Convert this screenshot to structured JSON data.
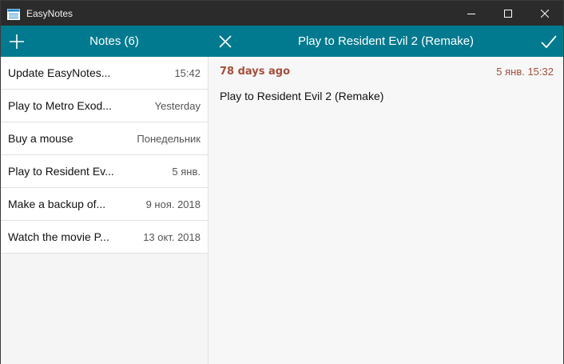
{
  "app": {
    "title": "EasyNotes"
  },
  "header": {
    "notes_title": "Notes (6)",
    "note_title": "Play to Resident Evil 2 (Remake)"
  },
  "notes": [
    {
      "title": "Update EasyNotes...",
      "date": "15:42"
    },
    {
      "title": "Play to Metro Exod...",
      "date": "Yesterday"
    },
    {
      "title": "Buy a mouse",
      "date": "Понедельник"
    },
    {
      "title": "Play to Resident Ev...",
      "date": "5 янв."
    },
    {
      "title": "Make a backup of...",
      "date": "9 ноя. 2018"
    },
    {
      "title": "Watch the movie P...",
      "date": "13 окт. 2018"
    }
  ],
  "detail": {
    "ago": "78 days ago",
    "timestamp": "5 янв. 15:32",
    "body": "Play to Resident Evil 2 (Remake)"
  },
  "colors": {
    "accent": "#017a8f",
    "titlebar": "#2b2b2b",
    "meta": "#a64f3c"
  },
  "icons": {
    "add": "plus-icon",
    "close": "close-icon",
    "save": "check-icon",
    "minimize": "minimize-icon",
    "maximize": "maximize-icon",
    "window_close": "window-close-icon"
  }
}
